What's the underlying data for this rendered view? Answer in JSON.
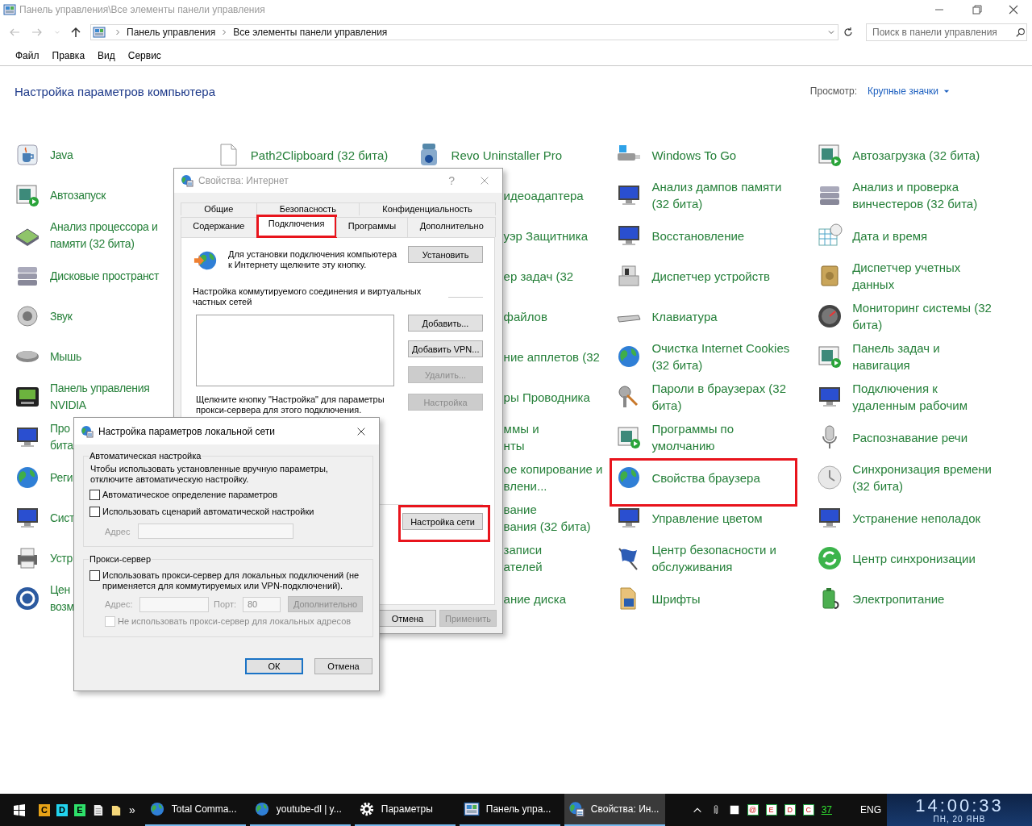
{
  "window": {
    "title": "Панель управления\\Все элементы панели управления"
  },
  "address": {
    "crumbs": [
      "Панель управления",
      "Все элементы панели управления"
    ]
  },
  "search": {
    "placeholder": "Поиск в панели управления"
  },
  "menu": [
    "Файл",
    "Правка",
    "Вид",
    "Сервис"
  ],
  "heading": "Настройка параметров компьютера",
  "view": {
    "label": "Просмотр:",
    "value": "Крупные значки"
  },
  "columns": [
    [
      {
        "lines": [
          "Java"
        ],
        "clipped": false,
        "highlighted": false
      },
      {
        "lines": [
          "Автозапуск"
        ],
        "clipped": false,
        "highlighted": false
      },
      {
        "lines": [
          "Анализ процессора и",
          "памяти (32 бита)"
        ],
        "clipped": false,
        "highlighted": false
      },
      {
        "lines": [
          "Дисковые пространст"
        ],
        "clipped": false,
        "highlighted": false
      },
      {
        "lines": [
          "Звук"
        ],
        "clipped": false,
        "highlighted": false
      },
      {
        "lines": [
          "Мышь"
        ],
        "clipped": false,
        "highlighted": false
      },
      {
        "lines": [
          "Панель управления",
          "NVIDIA"
        ],
        "clipped": false,
        "highlighted": false
      },
      {
        "lines": [
          "Про",
          "бита"
        ],
        "clipped": false,
        "highlighted": false
      },
      {
        "lines": [
          "Реги"
        ],
        "clipped": false,
        "highlighted": false
      },
      {
        "lines": [
          "Сист"
        ],
        "clipped": false,
        "highlighted": false
      },
      {
        "lines": [
          "Устр"
        ],
        "clipped": false,
        "highlighted": false
      },
      {
        "lines": [
          "Цен",
          "возм"
        ],
        "clipped": false,
        "highlighted": false
      }
    ],
    [
      {
        "lines": [
          "Path2Clipboard (32 бита)"
        ],
        "clipped": false,
        "highlighted": false
      }
    ],
    [
      {
        "lines": [
          "Revo Uninstaller Pro"
        ],
        "clipped": false,
        "highlighted": false
      },
      {
        "lines": [
          "идеоадаптера"
        ],
        "clipped": true,
        "highlighted": false
      },
      {
        "lines": [
          "уэр Защитника"
        ],
        "clipped": true,
        "highlighted": false
      },
      {
        "lines": [
          "ер задач (32"
        ],
        "clipped": true,
        "highlighted": false
      },
      {
        "lines": [
          "файлов"
        ],
        "clipped": true,
        "highlighted": false
      },
      {
        "lines": [
          "ние апплетов (32"
        ],
        "clipped": true,
        "highlighted": false
      },
      {
        "lines": [
          "ры Проводника"
        ],
        "clipped": true,
        "highlighted": false
      },
      {
        "lines": [
          "ммы и",
          "нты"
        ],
        "clipped": true,
        "highlighted": false
      },
      {
        "lines": [
          "ое копирование и",
          "влени..."
        ],
        "clipped": true,
        "highlighted": false
      },
      {
        "lines": [
          "вание",
          "вания (32 бита)"
        ],
        "clipped": true,
        "highlighted": false
      },
      {
        "lines": [
          "записи",
          "ателей"
        ],
        "clipped": true,
        "highlighted": false
      },
      {
        "lines": [
          "ание диска"
        ],
        "clipped": true,
        "highlighted": false
      }
    ],
    [
      {
        "lines": [
          "Windows To Go"
        ],
        "clipped": false,
        "highlighted": false
      },
      {
        "lines": [
          "Анализ дампов памяти",
          "(32 бита)"
        ],
        "clipped": false,
        "highlighted": false
      },
      {
        "lines": [
          "Восстановление"
        ],
        "clipped": false,
        "highlighted": false
      },
      {
        "lines": [
          "Диспетчер устройств"
        ],
        "clipped": false,
        "highlighted": false
      },
      {
        "lines": [
          "Клавиатура"
        ],
        "clipped": false,
        "highlighted": false
      },
      {
        "lines": [
          "Очистка Internet Cookies",
          "(32 бита)"
        ],
        "clipped": false,
        "highlighted": false
      },
      {
        "lines": [
          "Пароли в браузерах (32",
          "бита)"
        ],
        "clipped": false,
        "highlighted": false
      },
      {
        "lines": [
          "Программы по",
          "умолчанию"
        ],
        "clipped": false,
        "highlighted": false
      },
      {
        "lines": [
          "Свойства браузера"
        ],
        "clipped": false,
        "highlighted": true
      },
      {
        "lines": [
          "Управление цветом"
        ],
        "clipped": false,
        "highlighted": false
      },
      {
        "lines": [
          "Центр безопасности и",
          "обслуживания"
        ],
        "clipped": false,
        "highlighted": false
      },
      {
        "lines": [
          "Шрифты"
        ],
        "clipped": false,
        "highlighted": false
      }
    ],
    [
      {
        "lines": [
          "Автозагрузка (32 бита)"
        ],
        "clipped": false,
        "highlighted": false
      },
      {
        "lines": [
          "Анализ и проверка",
          "винчестеров (32 бита)"
        ],
        "clipped": false,
        "highlighted": false
      },
      {
        "lines": [
          "Дата и время"
        ],
        "clipped": false,
        "highlighted": false
      },
      {
        "lines": [
          "Диспетчер учетных",
          "данных"
        ],
        "clipped": false,
        "highlighted": false
      },
      {
        "lines": [
          "Мониторинг системы (32",
          "бита)"
        ],
        "clipped": false,
        "highlighted": false
      },
      {
        "lines": [
          "Панель задач и",
          "навигация"
        ],
        "clipped": false,
        "highlighted": false
      },
      {
        "lines": [
          "Подключения к",
          "удаленным рабочим"
        ],
        "clipped": false,
        "highlighted": false
      },
      {
        "lines": [
          "Распознавание речи"
        ],
        "clipped": false,
        "highlighted": false
      },
      {
        "lines": [
          "Синхронизация времени",
          "(32 бита)"
        ],
        "clipped": false,
        "highlighted": false
      },
      {
        "lines": [
          "Устранение неполадок"
        ],
        "clipped": false,
        "highlighted": false
      },
      {
        "lines": [
          "Центр синхронизации"
        ],
        "clipped": false,
        "highlighted": false
      },
      {
        "lines": [
          "Электропитание"
        ],
        "clipped": false,
        "highlighted": false
      }
    ]
  ],
  "internet_dialog": {
    "title": "Свойства: Интернет",
    "help": "?",
    "tab_rows": [
      [
        {
          "label": "Общие",
          "selected": false,
          "highlighted": false
        },
        {
          "label": "Безопасность",
          "selected": false,
          "highlighted": false
        },
        {
          "label": "Конфиденциальность",
          "selected": false,
          "highlighted": false
        }
      ],
      [
        {
          "label": "Содержание",
          "selected": false,
          "highlighted": false
        },
        {
          "label": "Подключения",
          "selected": true,
          "highlighted": true
        },
        {
          "label": "Программы",
          "selected": false,
          "highlighted": false
        },
        {
          "label": "Дополнительно",
          "selected": false,
          "highlighted": false
        }
      ]
    ],
    "setup_text": [
      "Для установки подключения компьютера",
      "к Интернету щелкните эту кнопку."
    ],
    "setup_button": {
      "label": "Установить",
      "disabled": false
    },
    "dialup_label": [
      "Настройка коммутируемого соединения и виртуальных",
      "частных сетей"
    ],
    "list_buttons": [
      {
        "label": "Добавить...",
        "disabled": false
      },
      {
        "label": "Добавить VPN...",
        "disabled": false
      },
      {
        "label": "Удалить...",
        "disabled": true
      }
    ],
    "proxy_hint": [
      "Щелкните кнопку \"Настройка\" для параметры",
      "прокси-сервера для этого подключения."
    ],
    "settings_button": {
      "label": "Настройка",
      "disabled": true
    },
    "lan_button": {
      "label": "Настройка сети",
      "disabled": false,
      "highlighted": true
    },
    "footer_buttons": [
      {
        "label": "Отмена",
        "disabled": false
      },
      {
        "label": "Применить",
        "disabled": true
      }
    ]
  },
  "lan_dialog": {
    "title": "Настройка параметров локальной сети",
    "auto": {
      "title": "Автоматическая настройка",
      "description": [
        "Чтобы использовать установленные вручную параметры,",
        "отключите автоматическую настройку."
      ],
      "checkboxes": [
        {
          "lines": [
            "Автоматическое определение параметров"
          ],
          "checked": false,
          "disabled": false
        },
        {
          "lines": [
            "Использовать сценарий автоматической настройки"
          ],
          "checked": false,
          "disabled": false
        }
      ],
      "address": {
        "label": "Адрес",
        "disabled": true
      }
    },
    "proxy": {
      "title": "Прокси-сервер",
      "use": {
        "lines": [
          "Использовать прокси-сервер для локальных подключений (не",
          "применяется для коммутируемых или VPN-подключений)."
        ],
        "checked": false,
        "disabled": false
      },
      "fields": {
        "address_label": "Адрес:",
        "port_label": "Порт:",
        "port_value": "80",
        "disabled": true
      },
      "advanced": {
        "label": "Дополнительно",
        "disabled": true
      },
      "bypass": {
        "lines": [
          "Не использовать прокси-сервер для локальных адресов"
        ],
        "checked": false,
        "disabled": true
      }
    },
    "buttons": [
      {
        "label": "ОК",
        "default": true
      },
      {
        "label": "Отмена",
        "default": false
      }
    ]
  },
  "taskbar": {
    "quick_launch": [
      {
        "label": "C",
        "color": "#e8a317"
      },
      {
        "label": "D",
        "color": "#22d3ee"
      },
      {
        "label": "E",
        "color": "#2ee06a"
      }
    ],
    "overflow": "»",
    "tasks": [
      {
        "label": "Total Comma...",
        "selected": false
      },
      {
        "label": "youtube-dl | y...",
        "selected": false
      },
      {
        "label": "Параметры",
        "selected": false
      },
      {
        "label": "Панель упра...",
        "selected": false
      },
      {
        "label": "Свойства: Ин...",
        "selected": true
      }
    ],
    "tray_badges": [
      "@",
      "E",
      "D",
      "C"
    ],
    "counter": "37",
    "language": "ENG"
  },
  "clock": {
    "time": "14:00:33",
    "date": "ПН, 20 ЯНВ"
  }
}
